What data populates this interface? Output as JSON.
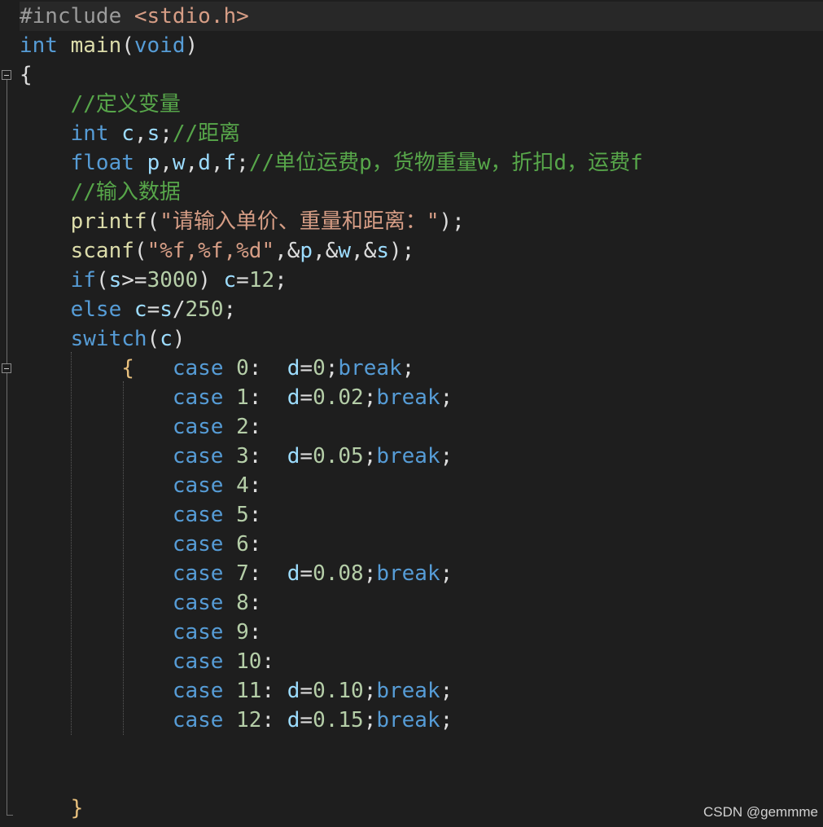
{
  "editor": {
    "lines": [
      [
        {
          "t": "#include ",
          "c": "pp"
        },
        {
          "t": "<stdio.h>",
          "c": "ppa"
        }
      ],
      [
        {
          "t": "int",
          "c": "kw"
        },
        {
          "t": " "
        },
        {
          "t": "main",
          "c": "fn"
        },
        {
          "t": "("
        },
        {
          "t": "void",
          "c": "kw"
        },
        {
          "t": ")"
        }
      ],
      [
        {
          "t": "{"
        }
      ],
      [
        {
          "t": "    "
        },
        {
          "t": "//定义变量",
          "c": "com"
        }
      ],
      [
        {
          "t": "    "
        },
        {
          "t": "int",
          "c": "kw"
        },
        {
          "t": " "
        },
        {
          "t": "c",
          "c": "var"
        },
        {
          "t": ","
        },
        {
          "t": "s",
          "c": "var"
        },
        {
          "t": ";"
        },
        {
          "t": "//距离",
          "c": "com"
        }
      ],
      [
        {
          "t": "    "
        },
        {
          "t": "float",
          "c": "kw"
        },
        {
          "t": " "
        },
        {
          "t": "p",
          "c": "var"
        },
        {
          "t": ","
        },
        {
          "t": "w",
          "c": "var"
        },
        {
          "t": ","
        },
        {
          "t": "d",
          "c": "var"
        },
        {
          "t": ","
        },
        {
          "t": "f",
          "c": "var"
        },
        {
          "t": ";"
        },
        {
          "t": "//单位运费p，货物重量w，折扣d，运费f",
          "c": "com"
        }
      ],
      [
        {
          "t": "    "
        },
        {
          "t": "//输入数据",
          "c": "com"
        }
      ],
      [
        {
          "t": "    "
        },
        {
          "t": "printf",
          "c": "fn"
        },
        {
          "t": "("
        },
        {
          "t": "\"请输入单价、重量和距离：\"",
          "c": "str"
        },
        {
          "t": ");"
        }
      ],
      [
        {
          "t": "    "
        },
        {
          "t": "scanf",
          "c": "fn"
        },
        {
          "t": "("
        },
        {
          "t": "\"%f,%f,%d\"",
          "c": "str"
        },
        {
          "t": ",&"
        },
        {
          "t": "p",
          "c": "var"
        },
        {
          "t": ",&"
        },
        {
          "t": "w",
          "c": "var"
        },
        {
          "t": ",&"
        },
        {
          "t": "s",
          "c": "var"
        },
        {
          "t": ");"
        }
      ],
      [
        {
          "t": "    "
        },
        {
          "t": "if",
          "c": "kw"
        },
        {
          "t": "("
        },
        {
          "t": "s",
          "c": "var"
        },
        {
          "t": ">="
        },
        {
          "t": "3000",
          "c": "num"
        },
        {
          "t": ") "
        },
        {
          "t": "c",
          "c": "var"
        },
        {
          "t": "="
        },
        {
          "t": "12",
          "c": "num"
        },
        {
          "t": ";"
        }
      ],
      [
        {
          "t": "    "
        },
        {
          "t": "else",
          "c": "kw"
        },
        {
          "t": " "
        },
        {
          "t": "c",
          "c": "var"
        },
        {
          "t": "="
        },
        {
          "t": "s",
          "c": "var"
        },
        {
          "t": "/"
        },
        {
          "t": "250",
          "c": "num"
        },
        {
          "t": ";"
        }
      ],
      [
        {
          "t": "    "
        },
        {
          "t": "switch",
          "c": "kw"
        },
        {
          "t": "("
        },
        {
          "t": "c",
          "c": "var"
        },
        {
          "t": ")"
        }
      ],
      [
        {
          "t": "        "
        },
        {
          "t": "{",
          "c": "brace"
        },
        {
          "t": "   "
        },
        {
          "t": "case",
          "c": "kw"
        },
        {
          "t": " "
        },
        {
          "t": "0",
          "c": "num"
        },
        {
          "t": ":  "
        },
        {
          "t": "d",
          "c": "var"
        },
        {
          "t": "="
        },
        {
          "t": "0",
          "c": "num"
        },
        {
          "t": ";"
        },
        {
          "t": "break",
          "c": "kw"
        },
        {
          "t": ";"
        }
      ],
      [
        {
          "t": "            "
        },
        {
          "t": "case",
          "c": "kw"
        },
        {
          "t": " "
        },
        {
          "t": "1",
          "c": "num"
        },
        {
          "t": ":  "
        },
        {
          "t": "d",
          "c": "var"
        },
        {
          "t": "="
        },
        {
          "t": "0.02",
          "c": "num"
        },
        {
          "t": ";"
        },
        {
          "t": "break",
          "c": "kw"
        },
        {
          "t": ";"
        }
      ],
      [
        {
          "t": "            "
        },
        {
          "t": "case",
          "c": "kw"
        },
        {
          "t": " "
        },
        {
          "t": "2",
          "c": "num"
        },
        {
          "t": ":"
        }
      ],
      [
        {
          "t": "            "
        },
        {
          "t": "case",
          "c": "kw"
        },
        {
          "t": " "
        },
        {
          "t": "3",
          "c": "num"
        },
        {
          "t": ":  "
        },
        {
          "t": "d",
          "c": "var"
        },
        {
          "t": "="
        },
        {
          "t": "0.05",
          "c": "num"
        },
        {
          "t": ";"
        },
        {
          "t": "break",
          "c": "kw"
        },
        {
          "t": ";"
        }
      ],
      [
        {
          "t": "            "
        },
        {
          "t": "case",
          "c": "kw"
        },
        {
          "t": " "
        },
        {
          "t": "4",
          "c": "num"
        },
        {
          "t": ":"
        }
      ],
      [
        {
          "t": "            "
        },
        {
          "t": "case",
          "c": "kw"
        },
        {
          "t": " "
        },
        {
          "t": "5",
          "c": "num"
        },
        {
          "t": ":"
        }
      ],
      [
        {
          "t": "            "
        },
        {
          "t": "case",
          "c": "kw"
        },
        {
          "t": " "
        },
        {
          "t": "6",
          "c": "num"
        },
        {
          "t": ":"
        }
      ],
      [
        {
          "t": "            "
        },
        {
          "t": "case",
          "c": "kw"
        },
        {
          "t": " "
        },
        {
          "t": "7",
          "c": "num"
        },
        {
          "t": ":  "
        },
        {
          "t": "d",
          "c": "var"
        },
        {
          "t": "="
        },
        {
          "t": "0.08",
          "c": "num"
        },
        {
          "t": ";"
        },
        {
          "t": "break",
          "c": "kw"
        },
        {
          "t": ";"
        }
      ],
      [
        {
          "t": "            "
        },
        {
          "t": "case",
          "c": "kw"
        },
        {
          "t": " "
        },
        {
          "t": "8",
          "c": "num"
        },
        {
          "t": ":"
        }
      ],
      [
        {
          "t": "            "
        },
        {
          "t": "case",
          "c": "kw"
        },
        {
          "t": " "
        },
        {
          "t": "9",
          "c": "num"
        },
        {
          "t": ":"
        }
      ],
      [
        {
          "t": "            "
        },
        {
          "t": "case",
          "c": "kw"
        },
        {
          "t": " "
        },
        {
          "t": "10",
          "c": "num"
        },
        {
          "t": ":"
        }
      ],
      [
        {
          "t": "            "
        },
        {
          "t": "case",
          "c": "kw"
        },
        {
          "t": " "
        },
        {
          "t": "11",
          "c": "num"
        },
        {
          "t": ": "
        },
        {
          "t": "d",
          "c": "var"
        },
        {
          "t": "="
        },
        {
          "t": "0.10",
          "c": "num"
        },
        {
          "t": ";"
        },
        {
          "t": "break",
          "c": "kw"
        },
        {
          "t": ";"
        }
      ],
      [
        {
          "t": "            "
        },
        {
          "t": "case",
          "c": "kw"
        },
        {
          "t": " "
        },
        {
          "t": "12",
          "c": "num"
        },
        {
          "t": ": "
        },
        {
          "t": "d",
          "c": "var"
        },
        {
          "t": "="
        },
        {
          "t": "0.15",
          "c": "num"
        },
        {
          "t": ";"
        },
        {
          "t": "break",
          "c": "kw"
        },
        {
          "t": ";"
        }
      ],
      [],
      [],
      [
        {
          "t": "    "
        },
        {
          "t": "}",
          "c": "brace"
        }
      ]
    ]
  },
  "watermark": "CSDN @gemmme",
  "colors": {
    "background": "#1e1e1e",
    "keyword": "#569cd6",
    "comment": "#57a64a",
    "string": "#d69d85",
    "function": "#dcdcaa",
    "variable": "#9cdcfe",
    "number": "#b5cea8"
  }
}
